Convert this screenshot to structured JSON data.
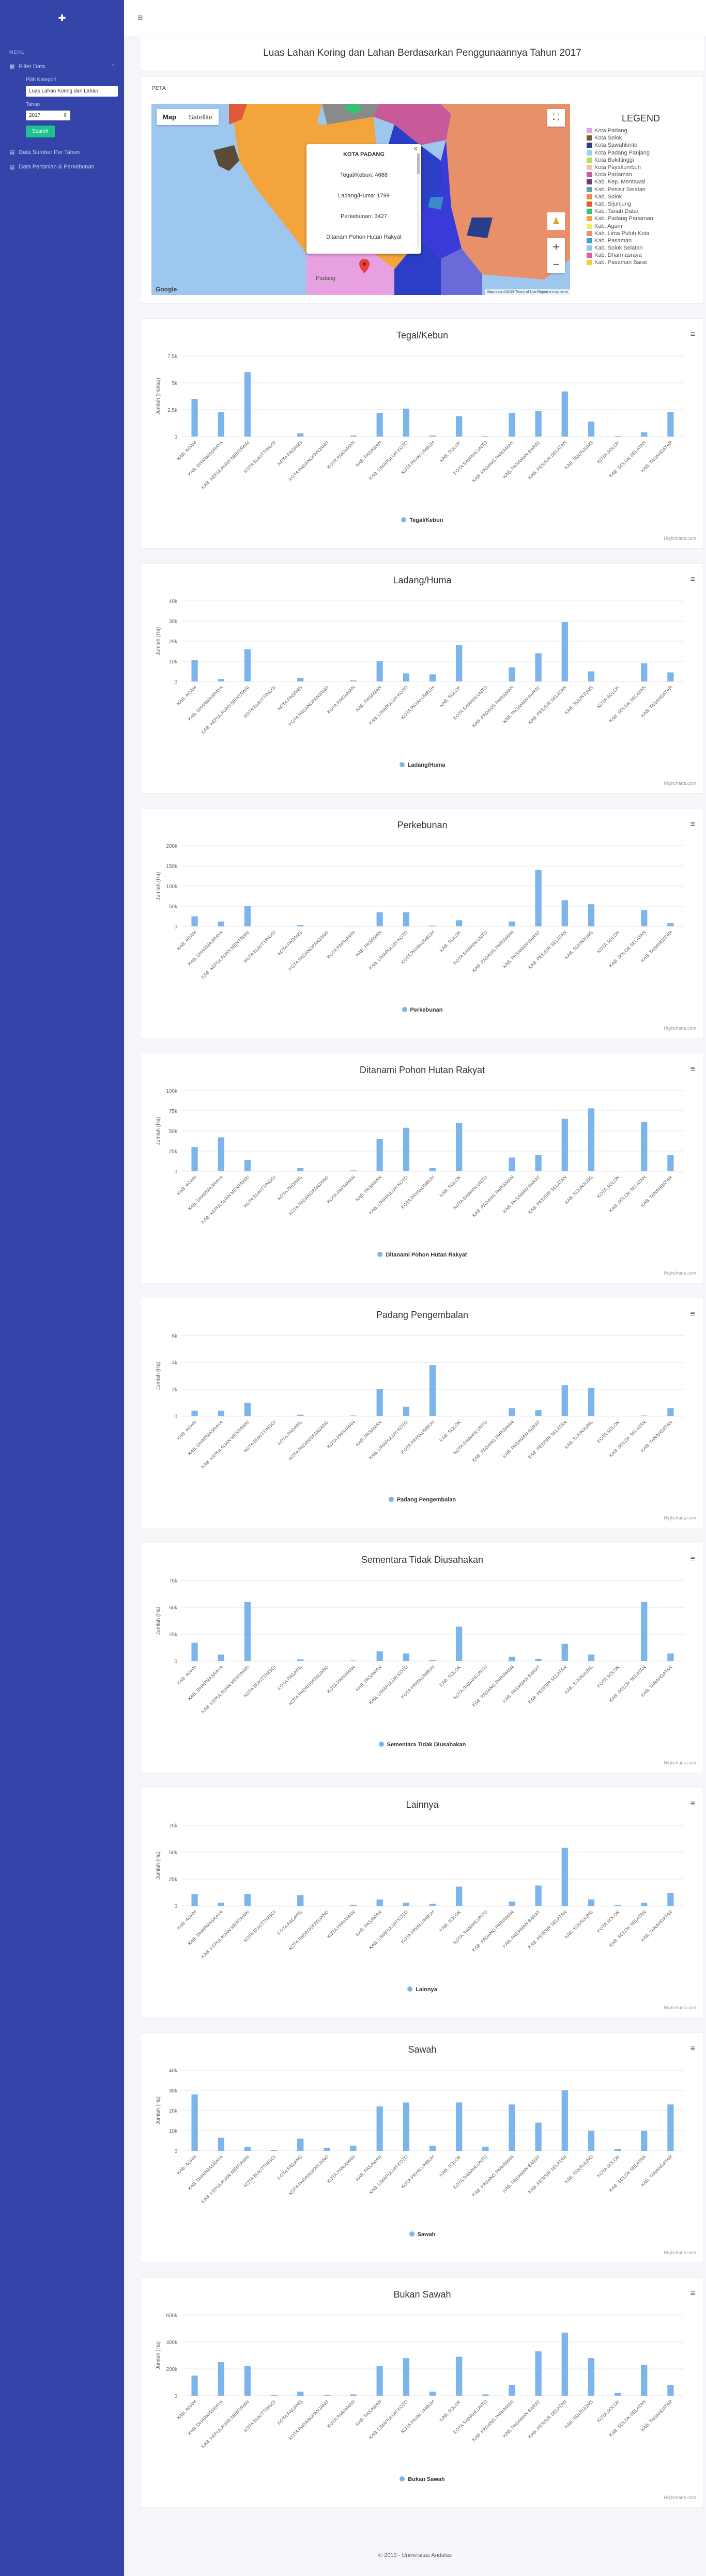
{
  "sidebar": {
    "menu_title": "MENU",
    "filter_label": "Filter Data",
    "kategori_label": "Pilih Kategori",
    "kategori_value": "Luas Lahan Koring dan Lahan",
    "tahun_label": "Tahun",
    "tahun_value": "2017",
    "search_label": "Search",
    "item_sumber": "Data Sumber Per Tahun",
    "item_pertanian": "Data Pertanian & Perkebunan"
  },
  "page": {
    "title": "Luas Lahan Koring dan Lahan Berdasarkan Penggunaannya Tahun 2017",
    "peta_label": "PETA"
  },
  "map": {
    "tab_map": "Map",
    "tab_satellite": "Satellite",
    "google": "Google",
    "attribution": "Map data ©2019  Terms of Use  Report a map error",
    "city_label": "Padang",
    "popup": {
      "title": "KOTA PADANG",
      "lines": [
        "Tegal/Kebun: 4688",
        "Ladang/Huma: 1799",
        "Perkebunan: 3427",
        "Ditanam Pohon Hutan Rakyat"
      ]
    }
  },
  "legend": {
    "title": "LEGEND",
    "items": [
      {
        "label": "Kota Padang",
        "color": "#e8a1e0"
      },
      {
        "label": "Kota Solok",
        "color": "#7b5a3a"
      },
      {
        "label": "Kota Sawahlunto",
        "color": "#2a3e8a"
      },
      {
        "label": "Kota Padang Panjang",
        "color": "#9ad3e8"
      },
      {
        "label": "Kota Bukittinggi",
        "color": "#b3e05a"
      },
      {
        "label": "Kota Payakumbuh",
        "color": "#f1c6a4"
      },
      {
        "label": "Kota Pariaman",
        "color": "#c85a9a"
      },
      {
        "label": "Kab. Kep. Mentawai",
        "color": "#6a3a8a"
      },
      {
        "label": "Kab. Pesisir Selatan",
        "color": "#5aa6a4"
      },
      {
        "label": "Kab. Solok",
        "color": "#e8903a"
      },
      {
        "label": "Kab. Sijunjung",
        "color": "#e05a3a"
      },
      {
        "label": "Kab. Tanah Datar",
        "color": "#2ec76a"
      },
      {
        "label": "Kab. Padang Pariaman",
        "color": "#f3a43a"
      },
      {
        "label": "Kab. Agam",
        "color": "#f0ee6a"
      },
      {
        "label": "Kab. Lima Puluh Kota",
        "color": "#e8906a"
      },
      {
        "label": "Kab. Pasaman",
        "color": "#3aa0c8"
      },
      {
        "label": "Kab. Solok Selatan",
        "color": "#8ac8e8"
      },
      {
        "label": "Kab. Dharmasraya",
        "color": "#e05aa0"
      },
      {
        "label": "Kab. Pasaman Barat",
        "color": "#f0d02a"
      }
    ]
  },
  "chart_data": [
    {
      "type": "bar",
      "title": "Tegal/Kebun",
      "ylabel": "Jumlah (Hektar)",
      "series_name": "Tegal/Kebun",
      "yticks": [
        "0",
        "2.5k",
        "5k",
        "7.5k"
      ],
      "ymax": 7500,
      "categories": [
        "KAB. AGAM",
        "KAB. DHARMASRAYA",
        "KAB. KEPULAUAN MENTAWAI",
        "KOTA BUKITTINGGI",
        "KOTA PADANG",
        "KOTA PADANGPANJANG",
        "KOTA PARIAMAN",
        "KAB. PASAMAN",
        "KAB. LIMAPULUH KOTO",
        "KOTA PAYAKUMBUH",
        "KAB. SOLOK",
        "KOTA SAWAHLUNTO",
        "KAB. PADANG PARIAMAN",
        "KAB. PASAMAN BARAT",
        "KAB. PESISIR SELATAN",
        "KAB. SIJUNJUNG",
        "KOTA SOLOK",
        "KAB. SOLOK SELATAN",
        "KAB. TANAHDATAR"
      ],
      "values": [
        3500,
        2300,
        6000,
        0,
        300,
        0,
        100,
        2200,
        2600,
        100,
        1900,
        50,
        2200,
        2400,
        4200,
        1400,
        50,
        400,
        2300
      ]
    },
    {
      "type": "bar",
      "title": "Ladang/Huma",
      "ylabel": "Jumlah (Ha)",
      "series_name": "Ladang/Huma",
      "yticks": [
        "0",
        "10k",
        "20k",
        "30k",
        "40k"
      ],
      "ymax": 40000,
      "categories": [
        "KAB. AGAM",
        "KAB. DHARMASRAYA",
        "KAB. KEPULAUAN MENTAWAI",
        "KOTA BUKITTINGGI",
        "KOTA PADANG",
        "KOTA PADANGPANJANG",
        "KOTA PARIAMAN",
        "KAB. PASAMAN",
        "KAB. LIMAPULUH KOTO",
        "KOTA PAYAKUMBUH",
        "KAB. SOLOK",
        "KOTA SAWAHLUNTO",
        "KAB. PADANG PARIAMAN",
        "KAB. PASAMAN BARAT",
        "KAB. PESISIR SELATAN",
        "KAB. SIJUNJUNG",
        "KOTA SOLOK",
        "KAB. SOLOK SELATAN",
        "KAB. TANAHDATAR"
      ],
      "values": [
        10500,
        1200,
        16000,
        0,
        1800,
        0,
        500,
        10000,
        4000,
        3500,
        18000,
        0,
        7000,
        14000,
        29500,
        5000,
        0,
        9000,
        4500
      ]
    },
    {
      "type": "bar",
      "title": "Perkebunan",
      "ylabel": "Jumlah (Ha)",
      "series_name": "Perkebunan",
      "yticks": [
        "0",
        "50k",
        "100k",
        "150k",
        "200k"
      ],
      "ymax": 200000,
      "categories": [
        "KAB. AGAM",
        "KAB. DHARMASRAYA",
        "KAB. KEPULAUAN MENTAWAI",
        "KOTA BUKITTINGGI",
        "KOTA PADANG",
        "KOTA PADANGPANJANG",
        "KOTA PARIAMAN",
        "KAB. PASAMAN",
        "KAB. LIMAPULUH KOTO",
        "KOTA PAYAKUMBUH",
        "KAB. SOLOK",
        "KOTA SAWAHLUNTO",
        "KAB. PADANG PARIAMAN",
        "KAB. PASAMAN BARAT",
        "KAB. PESISIR SELATAN",
        "KAB. SIJUNJUNG",
        "KOTA SOLOK",
        "KAB. SOLOK SELATAN",
        "KAB. TANAHDATAR"
      ],
      "values": [
        25000,
        12000,
        50000,
        0,
        3500,
        0,
        1000,
        35000,
        35000,
        2000,
        15000,
        0,
        12000,
        140000,
        65000,
        55000,
        0,
        40000,
        8000
      ]
    },
    {
      "type": "bar",
      "title": "Ditanami Pohon Hutan Rakyat",
      "ylabel": "Jumlah (Ha)",
      "series_name": "Ditanami Pohon Hutan Rakyat",
      "yticks": [
        "0",
        "25k",
        "50k",
        "75k",
        "100k"
      ],
      "ymax": 100000,
      "categories": [
        "KAB. AGAM",
        "KAB. DHARMASRAYA",
        "KAB. KEPULAUAN MENTAWAI",
        "KOTA BUKITTINGGI",
        "KOTA PADANG",
        "KOTA PADANGPANJANG",
        "KOTA PARIAMAN",
        "KAB. PASAMAN",
        "KAB. LIMAPULUH KOTO",
        "KOTA PAYAKUMBUH",
        "KAB. SOLOK",
        "KOTA SAWAHLUNTO",
        "KAB. PADANG PARIAMAN",
        "KAB. PASAMAN BARAT",
        "KAB. PESISIR SELATAN",
        "KAB. SIJUNJUNG",
        "KOTA SOLOK",
        "KAB. SOLOK SELATAN",
        "KAB. TANAHDATAR"
      ],
      "values": [
        30000,
        42000,
        14000,
        0,
        4000,
        0,
        1000,
        40000,
        54000,
        4000,
        60000,
        0,
        17000,
        20000,
        65000,
        78000,
        0,
        61000,
        20000
      ]
    },
    {
      "type": "bar",
      "title": "Padang Pengembalan",
      "ylabel": "Jumlah (Ha)",
      "series_name": "Padang Pengembalan",
      "yticks": [
        "0",
        "2k",
        "4k",
        "6k"
      ],
      "ymax": 6000,
      "categories": [
        "KAB. AGAM",
        "KAB. DHARMASRAYA",
        "KAB. KEPULAUAN MENTAWAI",
        "KOTA BUKITTINGGI",
        "KOTA PADANG",
        "KOTA PADANGPANJANG",
        "KOTA PARIAMAN",
        "KAB. PASAMAN",
        "KAB. LIMAPULUH KOTO",
        "KOTA PAYAKUMBUH",
        "KAB. SOLOK",
        "KOTA SAWAHLUNTO",
        "KAB. PADANG PARIAMAN",
        "KAB. PASAMAN BARAT",
        "KAB. PESISIR SELATAN",
        "KAB. SIJUNJUNG",
        "KOTA SOLOK",
        "KAB. SOLOK SELATAN",
        "KAB. TANAHDATAR"
      ],
      "values": [
        400,
        400,
        1000,
        0,
        100,
        0,
        50,
        2000,
        700,
        3800,
        0,
        0,
        600,
        450,
        2300,
        2100,
        0,
        50,
        600
      ]
    },
    {
      "type": "bar",
      "title": "Sementara Tidak Diusahakan",
      "ylabel": "Jumlah (Ha)",
      "series_name": "Sementara Tidak Diusahakan",
      "yticks": [
        "0",
        "25k",
        "50k",
        "75k"
      ],
      "ymax": 75000,
      "categories": [
        "KAB. AGAM",
        "KAB. DHARMASRAYA",
        "KAB. KEPULAUAN MENTAWAI",
        "KOTA BUKITTINGGI",
        "KOTA PADANG",
        "KOTA PADANGPANJANG",
        "KOTA PARIAMAN",
        "KAB. PASAMAN",
        "KAB. LIMAPULUH KOTO",
        "KOTA PAYAKUMBUH",
        "KAB. SOLOK",
        "KOTA SAWAHLUNTO",
        "KAB. PADANG PARIAMAN",
        "KAB. PASAMAN BARAT",
        "KAB. PESISIR SELATAN",
        "KAB. SIJUNJUNG",
        "KOTA SOLOK",
        "KAB. SOLOK SELATAN",
        "KAB. TANAHDATAR"
      ],
      "values": [
        17000,
        6000,
        55000,
        0,
        1500,
        0,
        500,
        9000,
        7000,
        1000,
        32000,
        0,
        4000,
        2000,
        16000,
        6000,
        0,
        55000,
        7000
      ]
    },
    {
      "type": "bar",
      "title": "Lainnya",
      "ylabel": "Jumlah (Ha)",
      "series_name": "Lainnya",
      "yticks": [
        "0",
        "25k",
        "50k",
        "75k"
      ],
      "ymax": 75000,
      "categories": [
        "KAB. AGAM",
        "KAB. DHARMASRAYA",
        "KAB. KEPULAUAN MENTAWAI",
        "KOTA BUKITTINGGI",
        "KOTA PADANG",
        "KOTA PADANGPANJANG",
        "KOTA PARIAMAN",
        "KAB. PASAMAN",
        "KAB. LIMAPULUH KOTO",
        "KOTA PAYAKUMBUH",
        "KAB. SOLOK",
        "KOTA SAWAHLUNTO",
        "KAB. PADANG PARIAMAN",
        "KAB. PASAMAN BARAT",
        "KAB. PESISIR SELATAN",
        "KAB. SIJUNJUNG",
        "KOTA SOLOK",
        "KAB. SOLOK SELATAN",
        "KAB. TANAHDATAR"
      ],
      "values": [
        11000,
        3000,
        11000,
        0,
        10000,
        0,
        1000,
        6000,
        3000,
        2000,
        18000,
        0,
        4000,
        19000,
        54000,
        6000,
        1000,
        3000,
        12000
      ]
    },
    {
      "type": "bar",
      "title": "Sawah",
      "ylabel": "Jumlah (Ha)",
      "series_name": "Sawah",
      "yticks": [
        "0",
        "10k",
        "20k",
        "30k",
        "40k"
      ],
      "ymax": 40000,
      "categories": [
        "KAB. AGAM",
        "KAB. DHARMASRAYA",
        "KAB. KEPULAUAN MENTAWAI",
        "KOTA BUKITTINGGI",
        "KOTA PADANG",
        "KOTA PADANGPANJANG",
        "KOTA PARIAMAN",
        "KAB. PASAMAN",
        "KAB. LIMAPULUH KOTO",
        "KOTA PAYAKUMBUH",
        "KAB. SOLOK",
        "KOTA SAWAHLUNTO",
        "KAB. PADANG PARIAMAN",
        "KAB. PASAMAN BARAT",
        "KAB. PESISIR SELATAN",
        "KAB. SIJUNJUNG",
        "KOTA SOLOK",
        "KAB. SOLOK SELATAN",
        "KAB. TANAHDATAR"
      ],
      "values": [
        28000,
        6500,
        2000,
        500,
        6000,
        1500,
        2500,
        22000,
        24000,
        2500,
        24000,
        2000,
        23000,
        14000,
        30000,
        10000,
        1000,
        10000,
        23000
      ]
    },
    {
      "type": "bar",
      "title": "Bukan Sawah",
      "ylabel": "Jumlah (Ha)",
      "series_name": "Bukan Sawah",
      "yticks": [
        "0",
        "200k",
        "400k",
        "600k"
      ],
      "ymax": 600000,
      "categories": [
        "KAB. AGAM",
        "KAB. DHARMASRAYA",
        "KAB. KEPULAUAN MENTAWAI",
        "KOTA BUKITTINGGI",
        "KOTA PADANG",
        "KOTA PADANGPANJANG",
        "KOTA PARIAMAN",
        "KAB. PASAMAN",
        "KAB. LIMAPULUH KOTO",
        "KOTA PAYAKUMBUH",
        "KAB. SOLOK",
        "KOTA SAWAHLUNTO",
        "KAB. PADANG PARIAMAN",
        "KAB. PASAMAN BARAT",
        "KAB. PESISIR SELATAN",
        "KAB. SIJUNJUNG",
        "KOTA SOLOK",
        "KAB. SOLOK SELATAN",
        "KAB. TANAHDATAR"
      ],
      "values": [
        150000,
        250000,
        220000,
        5000,
        30000,
        5000,
        10000,
        220000,
        280000,
        30000,
        290000,
        10000,
        80000,
        330000,
        470000,
        280000,
        20000,
        230000,
        80000
      ]
    }
  ],
  "chart_credits": "Highcharts.com",
  "footer": "© 2019 - Universitas Andalas"
}
